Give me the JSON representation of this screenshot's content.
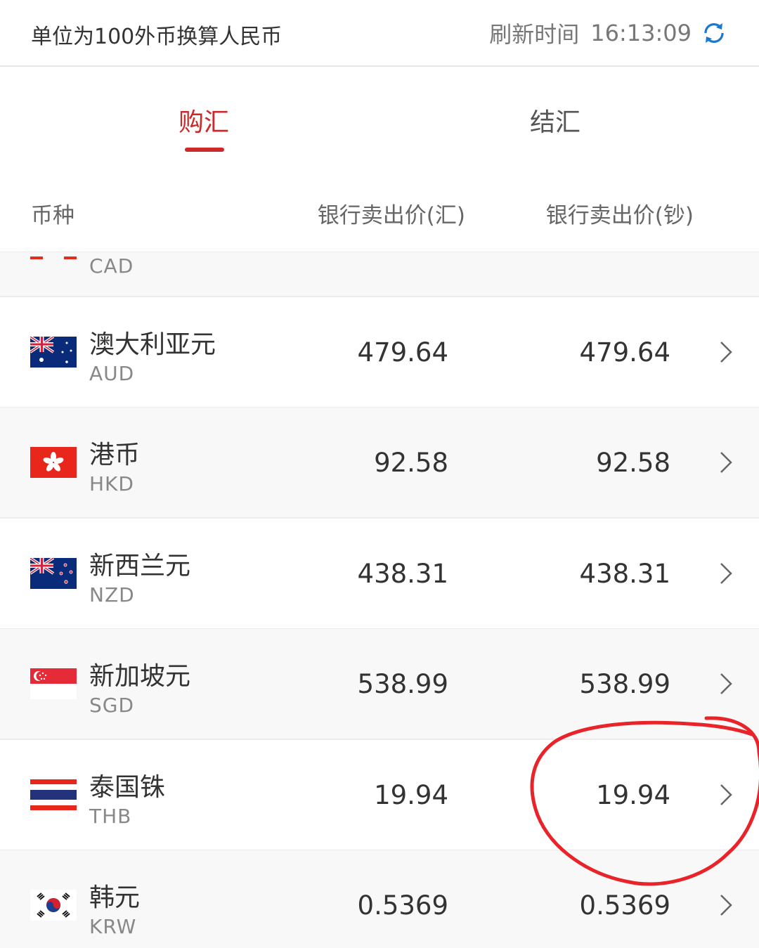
{
  "header": {
    "unit_note": "单位为100外币换算人民币",
    "refresh_label": "刷新时间",
    "refresh_time": "16:13:09"
  },
  "tabs": [
    {
      "label": "购汇",
      "active": true
    },
    {
      "label": "结汇",
      "active": false
    }
  ],
  "columns": {
    "currency": "币种",
    "sell_transfer": "银行卖出价(汇)",
    "sell_cash": "银行卖出价(钞)"
  },
  "rows": [
    {
      "name": "",
      "code": "CAD",
      "transfer": "",
      "cash": "",
      "flag_icon": "canada-flag-icon"
    },
    {
      "name": "澳大利亚元",
      "code": "AUD",
      "transfer": "479.64",
      "cash": "479.64",
      "flag_icon": "australia-flag-icon"
    },
    {
      "name": "港币",
      "code": "HKD",
      "transfer": "92.58",
      "cash": "92.58",
      "flag_icon": "hong-kong-flag-icon"
    },
    {
      "name": "新西兰元",
      "code": "NZD",
      "transfer": "438.31",
      "cash": "438.31",
      "flag_icon": "new-zealand-flag-icon"
    },
    {
      "name": "新加坡元",
      "code": "SGD",
      "transfer": "538.99",
      "cash": "538.99",
      "flag_icon": "singapore-flag-icon"
    },
    {
      "name": "泰国铢",
      "code": "THB",
      "transfer": "19.94",
      "cash": "19.94",
      "flag_icon": "thailand-flag-icon"
    },
    {
      "name": "韩元",
      "code": "KRW",
      "transfer": "0.5369",
      "cash": "0.5369",
      "flag_icon": "korea-flag-icon"
    }
  ],
  "colors": {
    "accent": "#cc2a2a",
    "refresh_icon": "#1a78d0",
    "annotation": "#e8242a"
  }
}
